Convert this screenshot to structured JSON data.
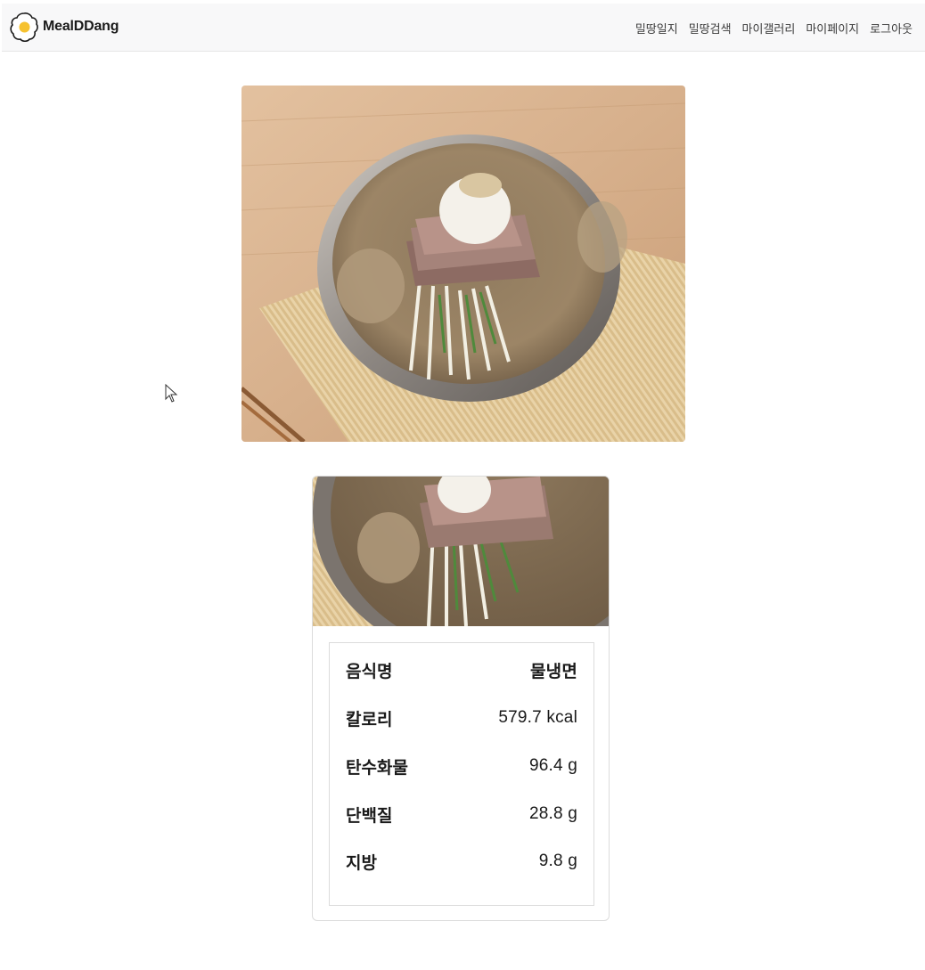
{
  "brand": {
    "name": "MealDDang",
    "logo_icon": "fried-egg-icon",
    "colors": {
      "yolk": "#f6c230"
    }
  },
  "nav": {
    "items": [
      {
        "label": "밀땅일지"
      },
      {
        "label": "밀땅검색"
      },
      {
        "label": "마이갤러리"
      },
      {
        "label": "마이페이지"
      },
      {
        "label": "로그아웃"
      }
    ]
  },
  "food": {
    "rows": [
      {
        "label": "음식명",
        "value": "물냉면"
      },
      {
        "label": "칼로리",
        "value": "579.7 kcal"
      },
      {
        "label": "탄수화물",
        "value": "96.4 g"
      },
      {
        "label": "단백질",
        "value": "28.8 g"
      },
      {
        "label": "지방",
        "value": "9.8 g"
      }
    ]
  }
}
